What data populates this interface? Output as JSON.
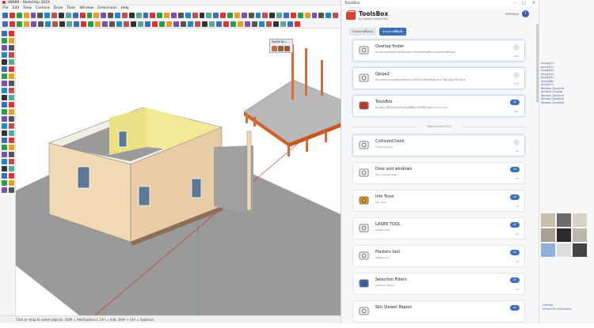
{
  "app": {
    "title": "88889 - SketchUp 2024"
  },
  "menu": [
    "File",
    "Edit",
    "View",
    "Camera",
    "Draw",
    "Tools",
    "Window",
    "Extensions",
    "Help"
  ],
  "tools_panel": {
    "title": "Profile Bu..."
  },
  "status": {
    "text": "Click or drag to select objects. Shift = Add/Subtract. Ctrl = Add. Shift + Ctrl = Subtract."
  },
  "toolsbox": {
    "window_title": "ToolsBox",
    "brand": "ToolsBox",
    "brand_sub": "by Sketch UniverCity",
    "user": "EMERALD",
    "avatar": "T",
    "tabs": [
      "ส่วนขยายทั้งหมด",
      "ส่วนขยายที่ติดตั้ง"
    ],
    "installed": [
      {
        "name": "Overlap finder",
        "desc": "ตรวจหาวัตถุซ้อนทับ ช่วยให้คุณจัดการโมเดลได้ง่ายขึ้นและลดขนาดไฟล์โมเดล",
        "action": "",
        "count": "100",
        "done": true,
        "icon": "magnifier-icon"
      },
      {
        "name": "Qpipe2",
        "desc": "สร้างท่อและรายละเอียดท่อได้อย่างรวดเร็วด้วยเครื่องมือเส้น ELEC ที่ดูง่ายและใช้งานง่าย",
        "action": "",
        "count": "770",
        "done": true,
        "icon": "pipe-icon"
      },
      {
        "name": "ToolsBox",
        "desc": "ToolsBox เป็นแหล่งรวมส่วนขยายที่พัฒนาโดยทีม Sketch UniverCity",
        "action": "แก้",
        "count": "100",
        "done": false,
        "icon": "toolbox-icon"
      }
    ],
    "section": "Sketch UniverCity",
    "others": [
      {
        "name": "CollisionCheck",
        "desc": "CollisionCheck",
        "action": "",
        "count": "40",
        "done": true,
        "icon": "collision-icon"
      },
      {
        "name": "Door and windows",
        "desc": "Door and windows",
        "action": "แก้",
        "count": "10",
        "done": false,
        "icon": "door-icon"
      },
      {
        "name": "Info Tools",
        "desc": "Info Tools",
        "action": "แก้",
        "count": "10",
        "done": false,
        "icon": "layers-icon"
      },
      {
        "name": "LASER TOOL",
        "desc": "LASER TOOL",
        "action": "แก้",
        "count": "10",
        "done": false,
        "icon": "laser-icon"
      },
      {
        "name": "Plasters tool",
        "desc": "Plaster tool",
        "action": "แก้",
        "count": "10",
        "done": false,
        "icon": "plaster-icon"
      },
      {
        "name": "Selection Filters",
        "desc": "Selection Filters",
        "action": "แก้",
        "count": "10",
        "done": false,
        "icon": "filter-icon"
      },
      {
        "name": "Skh Viewer Report",
        "desc": "",
        "action": "แก้",
        "count": "",
        "done": false,
        "icon": "report-icon"
      }
    ]
  },
  "right_panel": {
    "lines": [
      "ening#1>",
      "ening#2>",
      "ening#3>",
      "ening#4>",
      "ening#5>",
      "ening#6>",
      "ening#7>",
      "Window_Double#",
      "Window_Single#",
      "Window_Double#",
      "Window_Double#",
      "Window_Double#"
    ],
    "footer": [
      "Overlap",
      "UniverCity Extensions"
    ]
  }
}
